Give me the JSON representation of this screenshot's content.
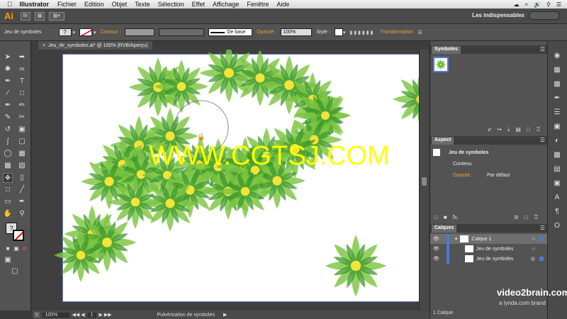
{
  "menubar": {
    "app": "Illustrator",
    "items": [
      "Fichier",
      "Edition",
      "Objet",
      "Texte",
      "Sélection",
      "Effet",
      "Affichage",
      "Fenêtre",
      "Aide"
    ]
  },
  "appbar": {
    "logo": "Ai",
    "br_label": "Br",
    "workspace": "Les indispensables"
  },
  "control": {
    "selection": "Jeu de symboles",
    "stroke_label": "Contour :",
    "style_name": "De base",
    "opacity_label": "Opacité :",
    "opacity_value": "100%",
    "style_label": "Style :",
    "transform_label": "Transformation"
  },
  "document": {
    "tab_title": "Jeu_de_symboles.ai* @ 100% (RVB/Aperçu)"
  },
  "statusbar": {
    "zoom": "100%",
    "page": "1",
    "tool_name": "Pulvérisation de symboles"
  },
  "panels": {
    "symbols_tab": "Symboles",
    "aspect_tab": "Aspect",
    "aspect_object": "Jeu de symboles",
    "aspect_content": "Contenu",
    "aspect_opacity_label": "Opacité :",
    "aspect_opacity_value": "Par défaut",
    "layers_tab": "Calques",
    "layer_name": "Calque 1",
    "sublayer_1": "Jeu de symboles",
    "sublayer_2": "Jeu de symboles",
    "layers_count": "1 Calque"
  },
  "watermark": "WWW.CGTSJ.COM",
  "brand": {
    "name": "video2brain.com",
    "sub": "a lynda.com brand"
  },
  "colors": {
    "accent": "#f0a030",
    "flower_dark": "#2f8a1e",
    "flower_light": "#7cc442",
    "flower_center": "#f3e33a"
  }
}
